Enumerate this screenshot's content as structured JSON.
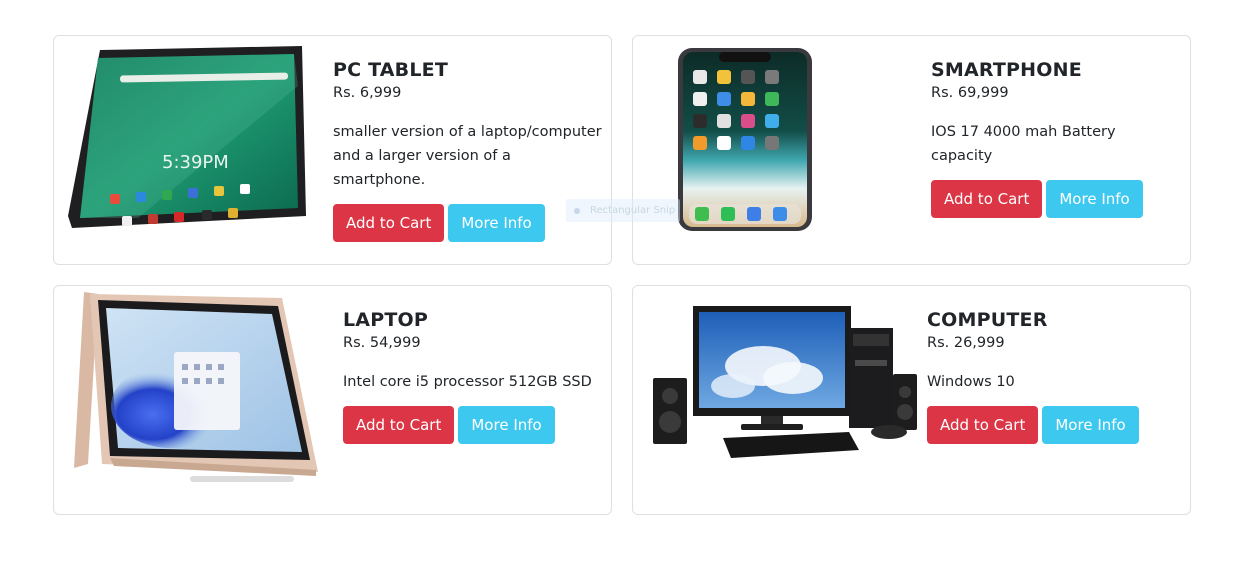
{
  "products": [
    {
      "name": "PC TABLET",
      "price": "Rs. 6,999",
      "description": "smaller version of a laptop/computer and a larger version of a smartphone.",
      "image_icon": "tablet-image",
      "screen_time": "5:39PM",
      "add_label": "Add to Cart",
      "info_label": "More Info"
    },
    {
      "name": "SMARTPHONE",
      "price": "Rs. 69,999",
      "description": "IOS 17 4000 mah Battery capacity",
      "image_icon": "smartphone-image",
      "add_label": "Add to Cart",
      "info_label": "More Info"
    },
    {
      "name": "LAPTOP",
      "price": "Rs. 54,999",
      "description": "Intel core i5 processor 512GB SSD",
      "image_icon": "laptop-image",
      "add_label": "Add to Cart",
      "info_label": "More Info"
    },
    {
      "name": "COMPUTER",
      "price": "Rs. 26,999",
      "description": "Windows 10",
      "image_icon": "desktop-computer-image",
      "add_label": "Add to Cart",
      "info_label": "More Info"
    }
  ],
  "overlay_tooltip": "Rectangular Snip",
  "colors": {
    "add_to_cart": "#dc3545",
    "more_info": "#3dc8ef",
    "card_border": "#dfdfdf"
  }
}
